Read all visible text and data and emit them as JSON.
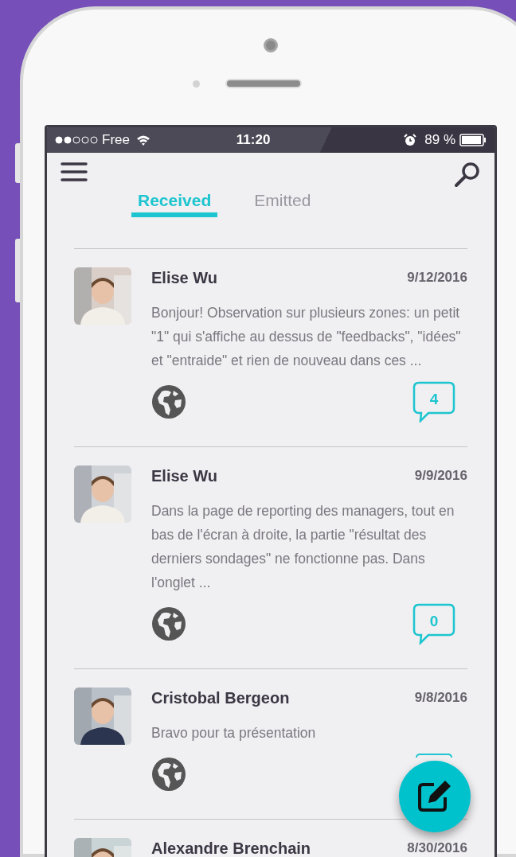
{
  "status_bar": {
    "carrier": "Free",
    "time": "11:20",
    "battery": "89 %"
  },
  "tabs": [
    {
      "label": "Received",
      "selected": true
    },
    {
      "label": "Emitted",
      "selected": false
    }
  ],
  "messages": [
    {
      "author": "Elise Wu",
      "date": "9/12/2016",
      "text": "Bonjour! Observation sur plusieurs zones: un petit \"1\" qui s'affiche au dessus de \"feedbacks\", \"idées\" et \"entraide\" et rien de nouveau dans ces ...",
      "comments": "4"
    },
    {
      "author": "Elise Wu",
      "date": "9/9/2016",
      "text": "Dans la page de reporting des managers, tout en bas de l'écran à droite, la partie \"résultat des derniers sondages\" ne fonctionne pas. Dans l'onglet ...",
      "comments": "0"
    },
    {
      "author": "Cristobal Bergeon",
      "date": "9/8/2016",
      "text": "Bravo pour ta présentation"
    },
    {
      "author": "Alexandre Brenchain",
      "date": "8/30/2016"
    }
  ]
}
